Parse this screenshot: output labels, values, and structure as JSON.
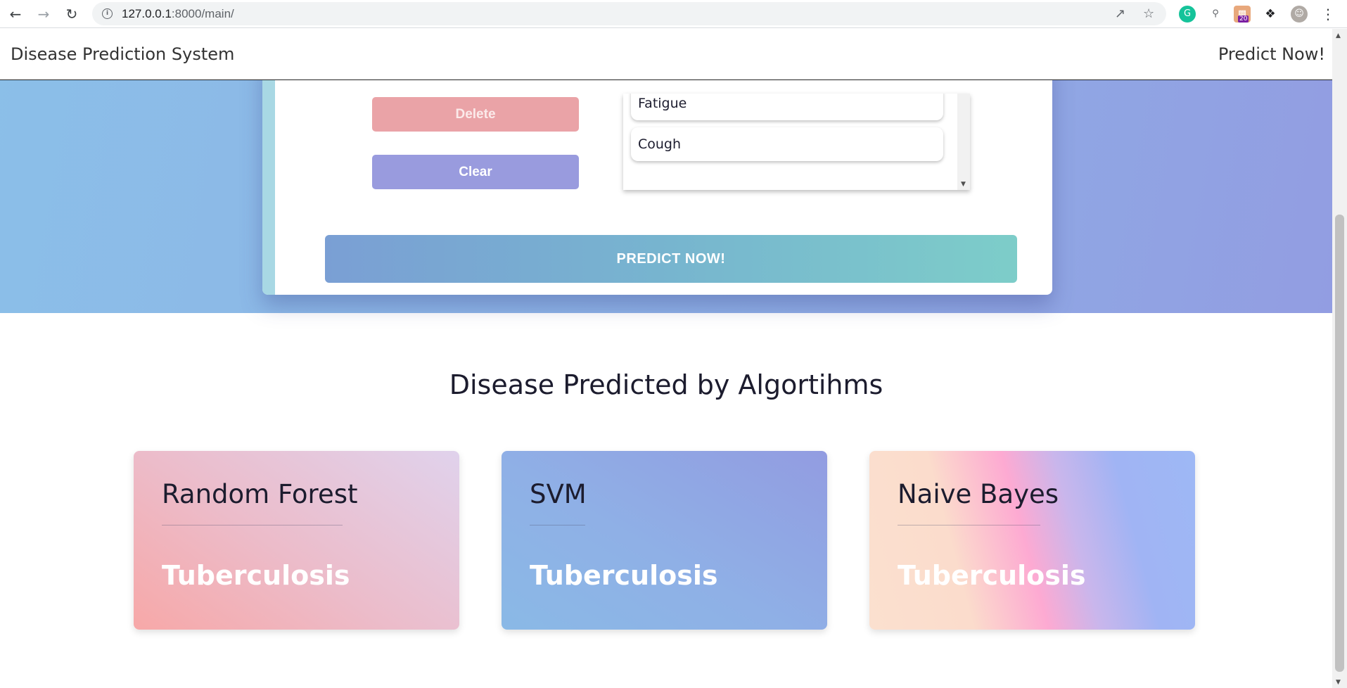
{
  "browser": {
    "url_host": "127.0.0.1",
    "url_rest": ":8000/main/",
    "extension_badge": "20"
  },
  "navbar": {
    "brand": "Disease Prediction System",
    "link": "Predict Now!"
  },
  "form": {
    "delete_label": "Delete",
    "clear_label": "Clear",
    "symptoms": [
      "Fatigue",
      "Cough"
    ],
    "predict_label": "PREDICT NOW!"
  },
  "results": {
    "title": "Disease Predicted by Algortihms",
    "cards": [
      {
        "algorithm": "Random Forest",
        "prediction": "Tuberculosis"
      },
      {
        "algorithm": "SVM",
        "prediction": "Tuberculosis"
      },
      {
        "algorithm": "Naive Bayes",
        "prediction": "Tuberculosis"
      }
    ]
  },
  "colors": {
    "hero_start": "#8bbfe8",
    "hero_end": "#929de2",
    "delete": "#eaa3a7",
    "clear": "#999bde"
  }
}
